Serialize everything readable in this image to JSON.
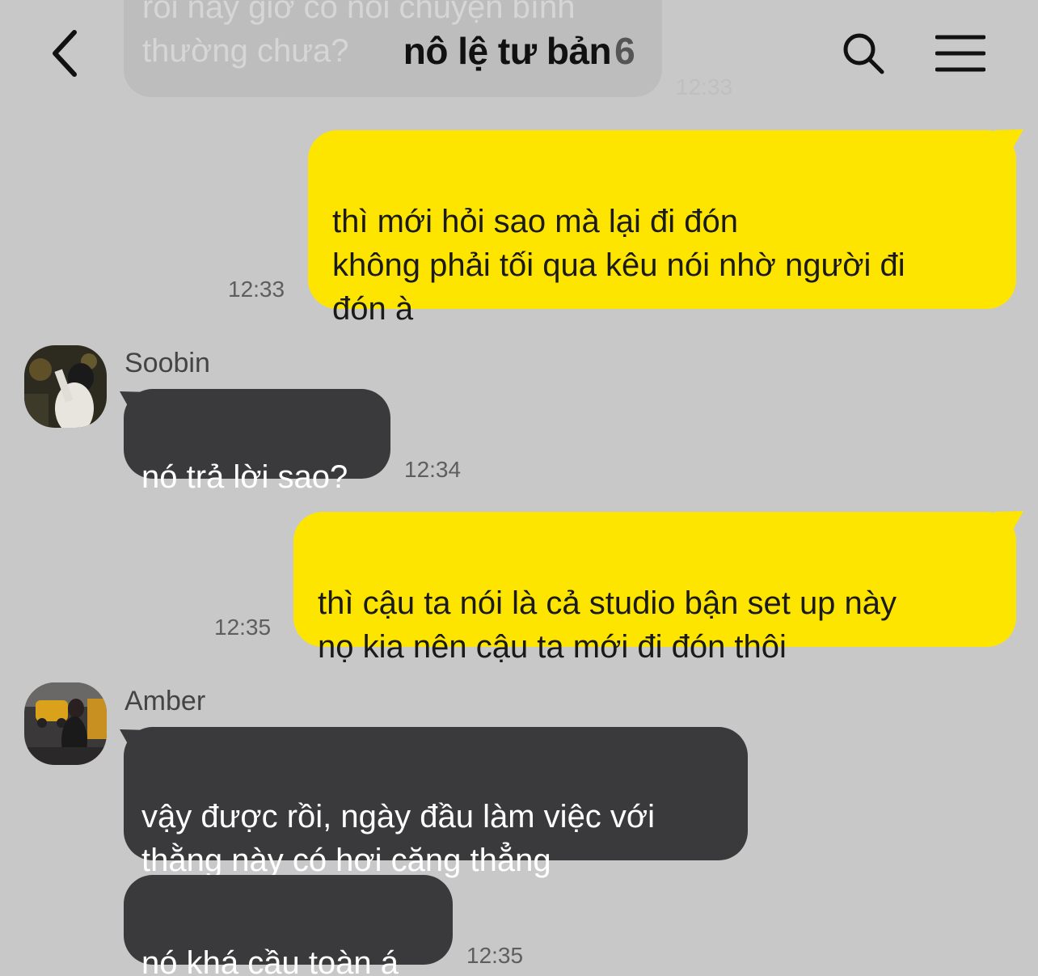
{
  "header": {
    "title": "nô lệ tư bản",
    "member_count": "6",
    "back_icon": "chevron-left-icon",
    "search_icon": "search-icon",
    "menu_icon": "hamburger-menu-icon"
  },
  "faded_message": {
    "text": "rồi này giờ có nói chuyện bình\nthường chưa?",
    "time": "12:33"
  },
  "messages": [
    {
      "side": "mine",
      "text": "thì mới hỏi sao mà lại đi đón\nkhông phải tối qua kêu nói nhờ người đi\nđón à",
      "time": "12:33"
    },
    {
      "side": "theirs",
      "sender": "Soobin",
      "text": "nó trả lời sao?",
      "time": "12:34"
    },
    {
      "side": "mine",
      "text": "thì cậu ta nói là cả studio bận set up này\nnọ kia nên cậu ta mới đi đón thôi",
      "time": "12:35"
    },
    {
      "side": "theirs",
      "sender": "Amber",
      "text": "vậy được rồi, ngày đầu làm việc với\nthằng này có hơi căng thẳng",
      "time": ""
    },
    {
      "side": "theirs",
      "text": "nó khá cầu toàn á",
      "time": "12:35"
    }
  ],
  "colors": {
    "background": "#c8c8c8",
    "my_bubble": "#fee500",
    "their_bubble": "#3a3a3c"
  }
}
